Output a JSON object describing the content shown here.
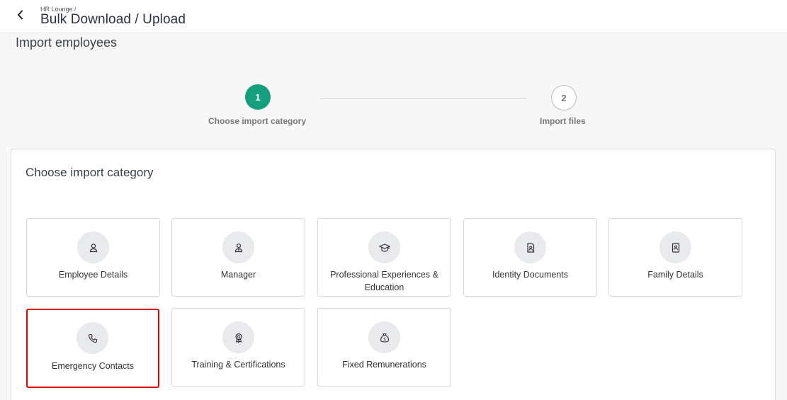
{
  "header": {
    "breadcrumb": "HR Lounge /",
    "title": "Bulk Download / Upload"
  },
  "page": {
    "section_title": "Import employees"
  },
  "stepper": {
    "steps": [
      {
        "number": "1",
        "label": "Choose import category",
        "state": "active"
      },
      {
        "number": "2",
        "label": "Import files",
        "state": "inactive"
      }
    ],
    "active_color": "#14a07f"
  },
  "card": {
    "title": "Choose import category",
    "tiles": [
      {
        "label": "Employee Details",
        "icon": "person-icon"
      },
      {
        "label": "Manager",
        "icon": "manager-icon"
      },
      {
        "label": "Professional Experiences & Education",
        "icon": "graduation-cap-icon"
      },
      {
        "label": "Identity Documents",
        "icon": "id-document-icon"
      },
      {
        "label": "Family Details",
        "icon": "contact-card-icon"
      },
      {
        "label": "Emergency Contacts",
        "icon": "phone-icon",
        "selected": true
      },
      {
        "label": "Training & Certifications",
        "icon": "award-ribbon-icon"
      },
      {
        "label": "Fixed Remunerations",
        "icon": "money-bag-icon"
      }
    ],
    "highlight_color": "#e00000"
  }
}
